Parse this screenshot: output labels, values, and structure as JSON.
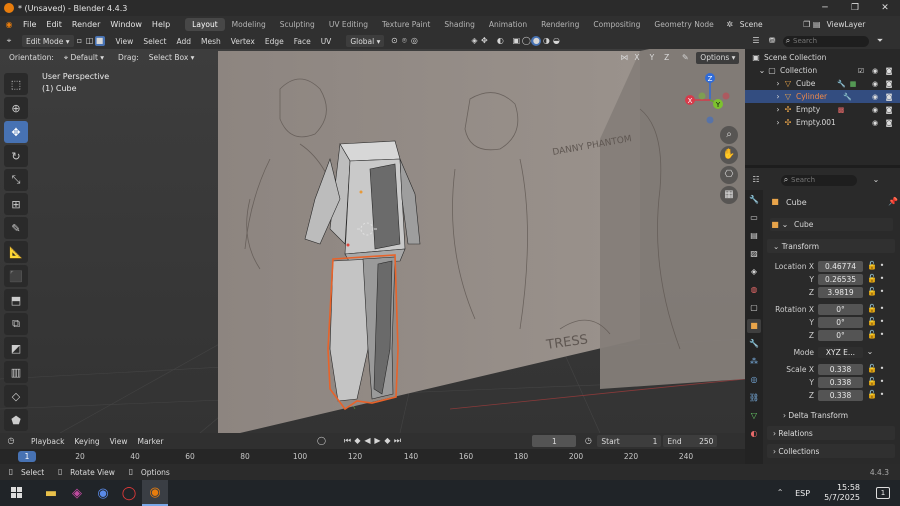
{
  "window": {
    "title": "* (Unsaved) - Blender 4.4.3"
  },
  "menu": [
    "File",
    "Edit",
    "Render",
    "Window",
    "Help"
  ],
  "workspaces": [
    "Layout",
    "Modeling",
    "Sculpting",
    "UV Editing",
    "Texture Paint",
    "Shading",
    "Animation",
    "Rendering",
    "Compositing",
    "Geometry Node"
  ],
  "active_workspace": "Layout",
  "scene": "Scene",
  "view_layer": "ViewLayer",
  "header": {
    "mode": "Edit Mode",
    "menus": [
      "View",
      "Select",
      "Add",
      "Mesh",
      "Vertex",
      "Edge",
      "Face",
      "UV"
    ],
    "orientation_global": "Global",
    "options": "Options"
  },
  "toolheader": {
    "orientation_label": "Orientation:",
    "orientation_value": "Default",
    "drag_label": "Drag:",
    "drag_value": "Select Box",
    "axes": [
      "X",
      "Y",
      "Z"
    ]
  },
  "viewport": {
    "perspective": "User Perspective",
    "object": "(1) Cube",
    "gizmo": [
      "X",
      "Y",
      "Z"
    ],
    "sketch_text": [
      "DANNY PHANTOM",
      "TRESS"
    ]
  },
  "outliner": {
    "search_placeholder": "Search",
    "items": [
      {
        "label": "Scene Collection",
        "icon": "scene-collection-icon"
      },
      {
        "label": "Collection",
        "icon": "collection-icon"
      },
      {
        "label": "Cube",
        "icon": "mesh-icon",
        "selected": false
      },
      {
        "label": "Cylinder",
        "icon": "mesh-icon",
        "selected": true
      },
      {
        "label": "Empty",
        "icon": "empty-icon",
        "selected": false
      },
      {
        "label": "Empty.001",
        "icon": "empty-icon",
        "selected": false
      }
    ]
  },
  "properties": {
    "search_placeholder": "Search",
    "object_name": "Cube",
    "datablock_name": "Cube",
    "transform_label": "Transform",
    "location_label": "Location X",
    "location": [
      "0.46774",
      "0.26535",
      "3.9819"
    ],
    "rotation_label": "Rotation X",
    "rotation": [
      "0°",
      "0°",
      "0°"
    ],
    "mode_label": "Mode",
    "mode_value": "XYZ E...",
    "scale_label": "Scale X",
    "scale": [
      "0.338",
      "0.338",
      "0.338"
    ],
    "axis_y": "Y",
    "axis_z": "Z",
    "delta_transform": "Delta Transform",
    "relations": "Relations",
    "collections": "Collections"
  },
  "timeline": {
    "menus": [
      "Playback",
      "Keying",
      "View",
      "Marker"
    ],
    "current_frame": "1",
    "start_label": "Start",
    "start": "1",
    "end_label": "End",
    "end": "250",
    "ruler": [
      "1",
      "20",
      "40",
      "60",
      "80",
      "100",
      "120",
      "140",
      "160",
      "180",
      "200",
      "220",
      "240"
    ]
  },
  "statusbar": {
    "select": "Select",
    "rotate": "Rotate View",
    "options": "Options",
    "version": "4.4.3"
  },
  "taskbar": {
    "language": "ESP",
    "time": "15:58",
    "date": "5/7/2025",
    "notification_count": "1"
  },
  "colors": {
    "accent": "#4772b3",
    "selection_outline": "#e8632a",
    "blender_orange": "#e87d0d"
  }
}
